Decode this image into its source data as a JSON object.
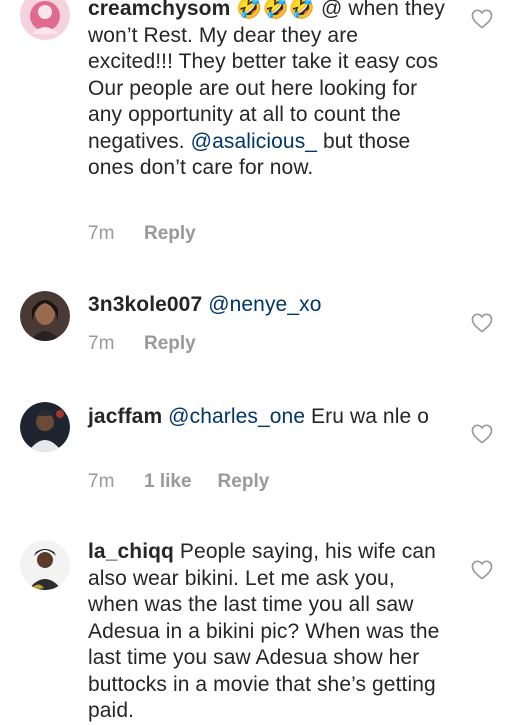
{
  "comments": [
    {
      "username": "creamchysom",
      "segments": [
        {
          "text": " 🤣🤣🤣 @ when they won’t Rest. My dear they are excited!!! They better take it easy cos Our people are out here looking for any opportunity at all to count the negatives. "
        },
        {
          "text": "@asalicious_",
          "mention": true
        },
        {
          "text": "  but those ones don’t care for now."
        }
      ],
      "time": "7m",
      "likes": "",
      "reply_label": "Reply"
    },
    {
      "username": "3n3kole007",
      "segments": [
        {
          "text": " "
        },
        {
          "text": "@nenye_xo",
          "mention": true
        }
      ],
      "time": "7m",
      "likes": "",
      "reply_label": "Reply"
    },
    {
      "username": "jacffam",
      "segments": [
        {
          "text": " "
        },
        {
          "text": "@charles_one",
          "mention": true
        },
        {
          "text": " Eru wa nle o"
        }
      ],
      "time": "7m",
      "likes": "1 like",
      "reply_label": "Reply"
    },
    {
      "username": "la_chiqq",
      "segments": [
        {
          "text": " People saying, his wife can also wear bikini. Let me ask you, when was the last time you all saw Adesua in a bikini pic? When was the last time you saw Adesua show her buttocks in a movie that she’s getting paid."
        }
      ],
      "time": "",
      "likes": "",
      "reply_label": ""
    }
  ],
  "icons": {
    "heart": "heart-outline-icon",
    "avatar": "avatar"
  },
  "colors": {
    "text": "#262626",
    "mention": "#003569",
    "meta": "#999999",
    "icon": "#999999"
  }
}
